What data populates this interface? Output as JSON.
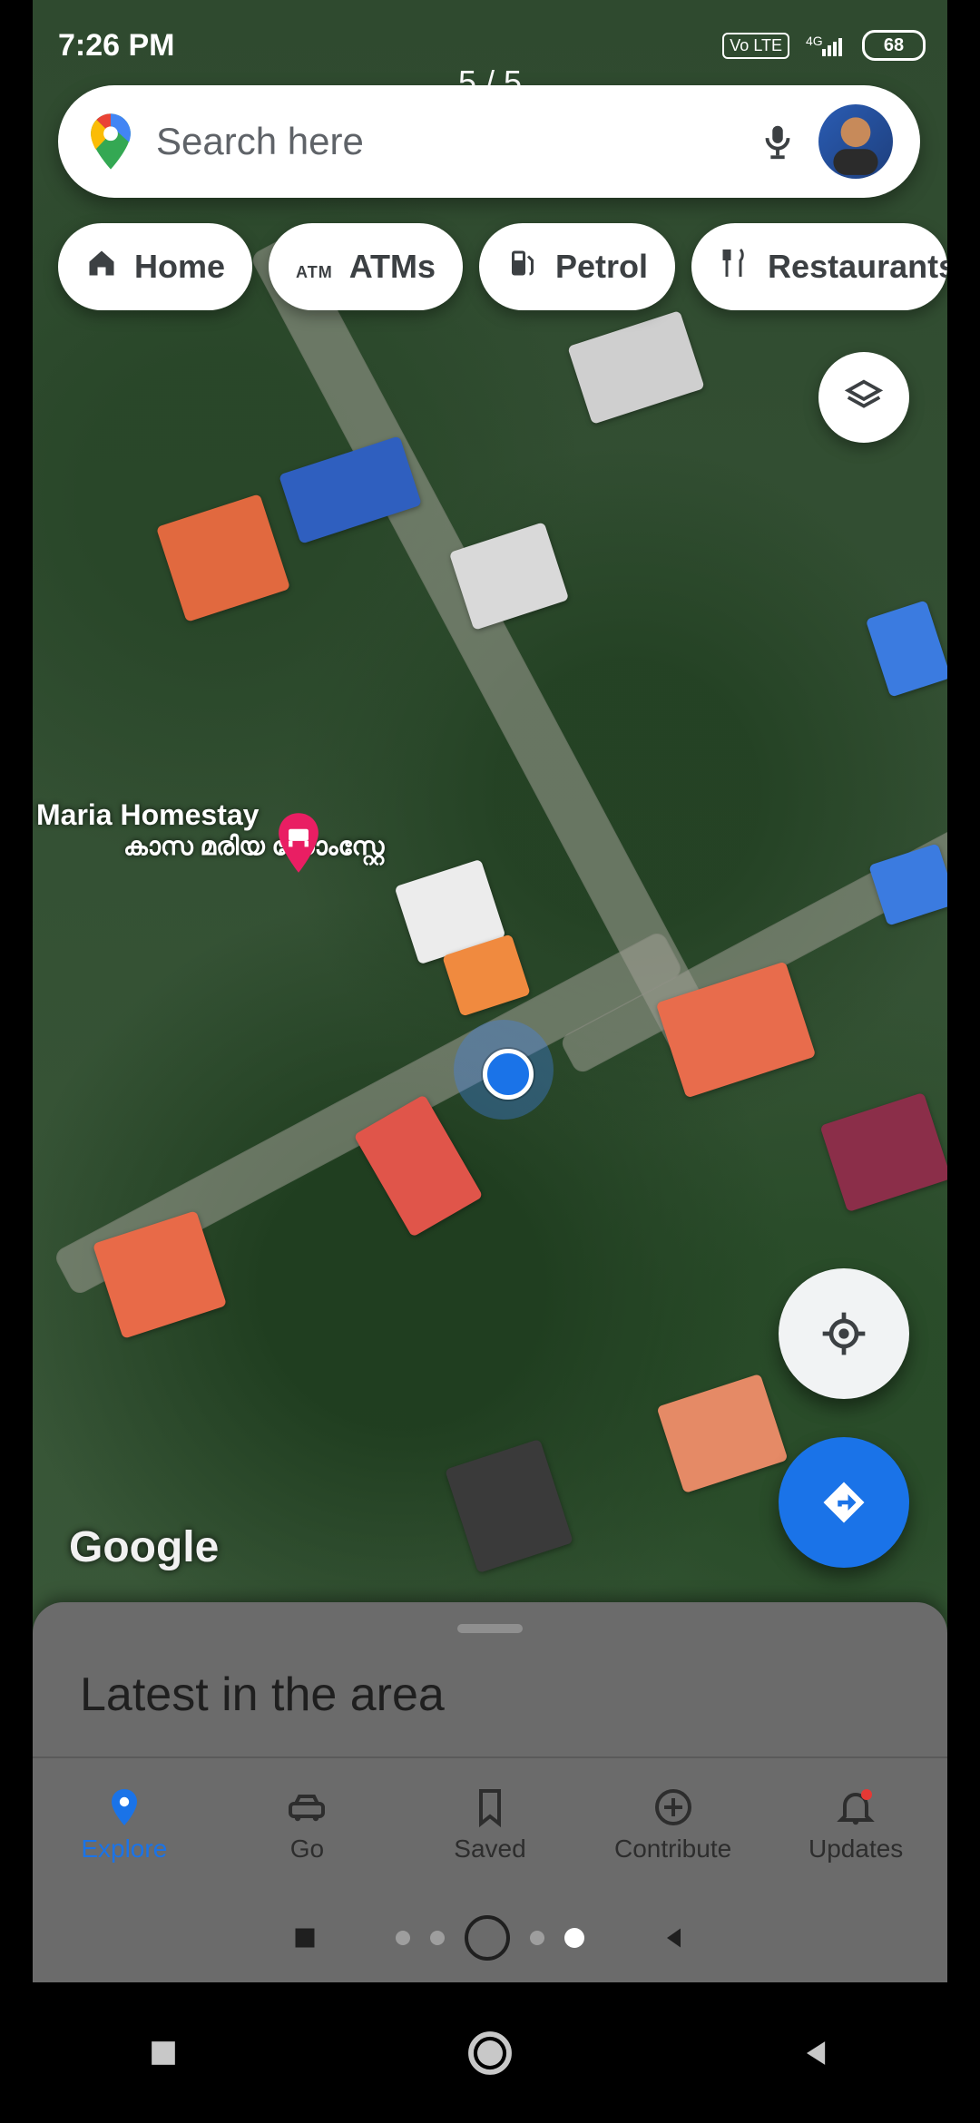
{
  "status_bar": {
    "time": "7:26 PM",
    "network_badge": "4G",
    "volte": "Vo LTE",
    "battery": "68"
  },
  "viewer": {
    "counter": "5 / 5"
  },
  "search": {
    "placeholder": "Search here"
  },
  "chips": [
    {
      "label": "Home",
      "icon": "home-icon"
    },
    {
      "label": "ATMs",
      "icon": "atm-icon",
      "icon_text": "ATM"
    },
    {
      "label": "Petrol",
      "icon": "fuel-icon"
    },
    {
      "label": "Restaurants",
      "icon": "restaurant-icon"
    }
  ],
  "map": {
    "place_name_en": "Maria Homestay",
    "place_name_ml": "കാസ മരിയ ഹോംസ്റ്റേ",
    "watermark": "Google"
  },
  "sheet": {
    "title": "Latest in the area"
  },
  "bottom_nav": [
    {
      "label": "Explore",
      "icon": "explore-pin-icon",
      "active": true
    },
    {
      "label": "Go",
      "icon": "car-icon",
      "active": false
    },
    {
      "label": "Saved",
      "icon": "bookmark-icon",
      "active": false
    },
    {
      "label": "Contribute",
      "icon": "plus-circle-icon",
      "active": false
    },
    {
      "label": "Updates",
      "icon": "bell-icon",
      "active": false
    }
  ],
  "colors": {
    "accent": "#1a73e8",
    "pin_pink": "#e91e63"
  }
}
